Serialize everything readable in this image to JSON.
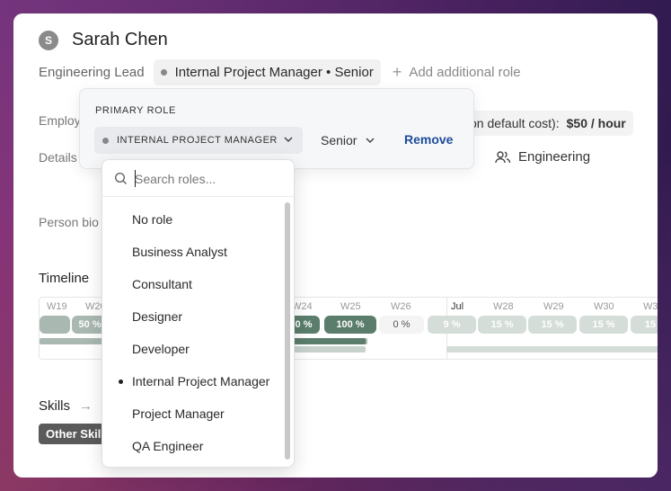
{
  "profile": {
    "avatar_initial": "S",
    "name": "Sarah Chen",
    "title": "Engineering Lead",
    "role_chip": "Internal Project Manager • Senior",
    "add_role": "Add additional role"
  },
  "fields": {
    "employment_label": "Employ",
    "details_label": "Details",
    "person_bio_label": "Person bio",
    "cost_label": "on default cost):",
    "cost_value": "$50 / hour",
    "department": "Engineering"
  },
  "timeline": {
    "title": "Timeline",
    "weeks": [
      "W19",
      "W20",
      "W24",
      "W25",
      "W26",
      "Jul",
      "W28",
      "W29",
      "W30",
      "W3"
    ],
    "pills": [
      "50 %",
      "0 %",
      "100 %",
      "0 %",
      "9 %",
      "15 %",
      "15 %",
      "15 %",
      "15"
    ]
  },
  "skills": {
    "title": "Skills",
    "chip": "Other Skil"
  },
  "popover": {
    "heading": "PRIMARY ROLE",
    "selected_role": "INTERNAL PROJECT MANAGER",
    "level": "Senior",
    "remove_label": "Remove"
  },
  "dropdown": {
    "search_placeholder": "Search roles...",
    "options": [
      {
        "label": "No role"
      },
      {
        "label": "Business Analyst"
      },
      {
        "label": "Consultant"
      },
      {
        "label": "Designer"
      },
      {
        "label": "Developer"
      },
      {
        "label": "Internal Project Manager",
        "selected": true
      },
      {
        "label": "Project Manager"
      },
      {
        "label": "QA Engineer"
      }
    ]
  },
  "colors": {
    "accent_green_dark": "#5b7d6c",
    "accent_green_light": "#d4ddd8",
    "link_blue": "#1e4c9a"
  }
}
